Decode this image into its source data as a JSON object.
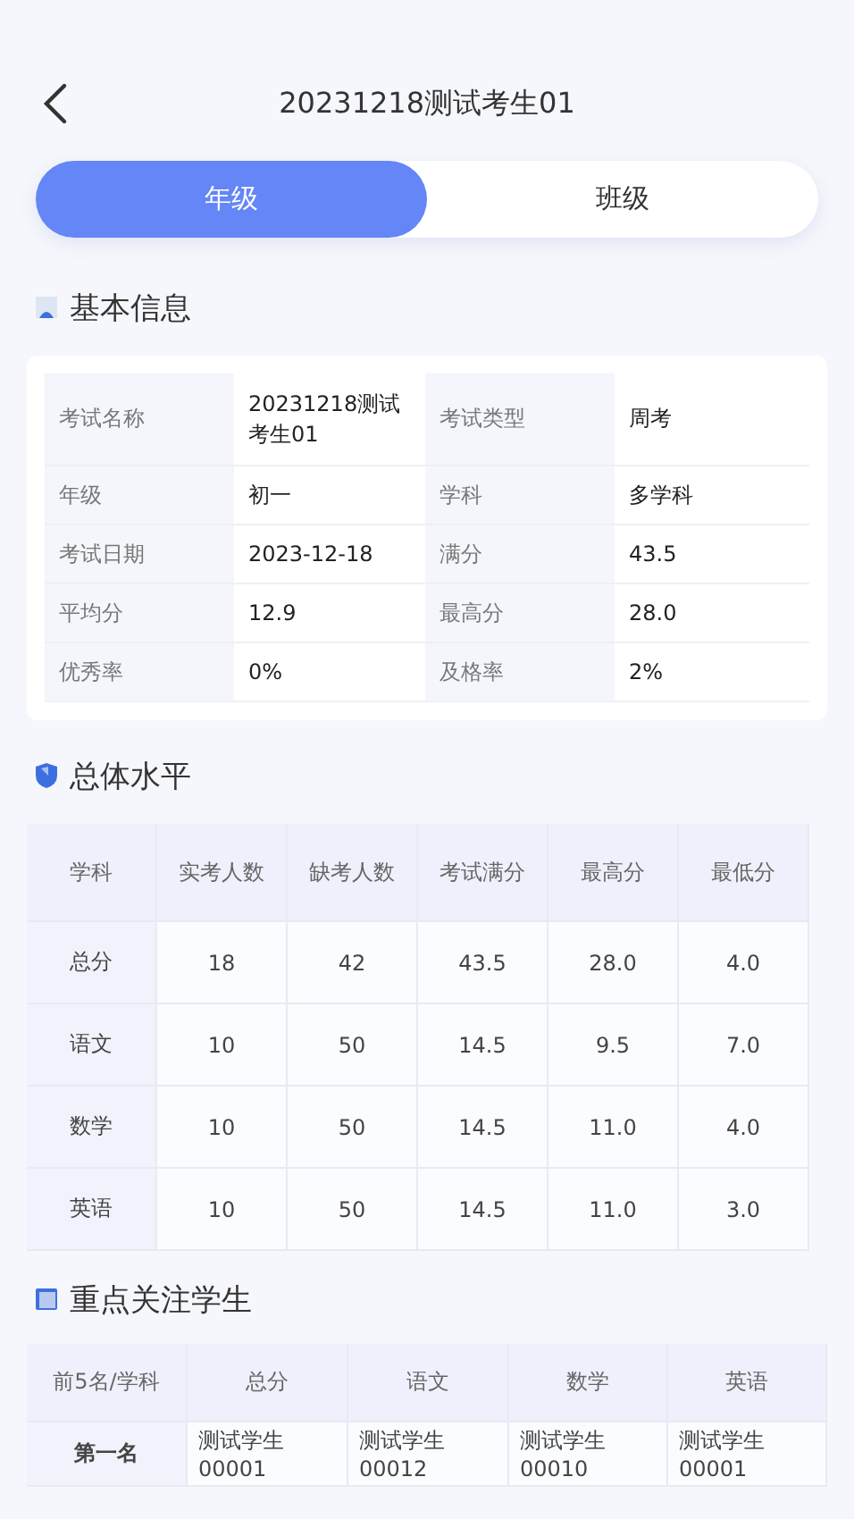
{
  "header": {
    "title": "20231218测试考生01"
  },
  "tabs": [
    {
      "label": "年级",
      "selected": true
    },
    {
      "label": "班级",
      "selected": false
    }
  ],
  "basic_info": {
    "title": "基本信息",
    "items": [
      {
        "label": "考试名称",
        "value": "20231218测试考生01"
      },
      {
        "label": "考试类型",
        "value": "周考"
      },
      {
        "label": "年级",
        "value": "初一"
      },
      {
        "label": "学科",
        "value": "多学科"
      },
      {
        "label": "考试日期",
        "value": "2023-12-18"
      },
      {
        "label": "满分",
        "value": "43.5"
      },
      {
        "label": "平均分",
        "value": "12.9"
      },
      {
        "label": "最高分",
        "value": "28.0"
      },
      {
        "label": "优秀率",
        "value": "0%"
      },
      {
        "label": "及格率",
        "value": "2%"
      }
    ]
  },
  "overall_level": {
    "title": "总体水平",
    "columns": [
      "学科",
      "实考人数",
      "缺考人数",
      "考试满分",
      "最高分",
      "最低分"
    ],
    "rows": [
      [
        "总分",
        "18",
        "42",
        "43.5",
        "28.0",
        "4.0"
      ],
      [
        "语文",
        "10",
        "50",
        "14.5",
        "9.5",
        "7.0"
      ],
      [
        "数学",
        "10",
        "50",
        "14.5",
        "11.0",
        "4.0"
      ],
      [
        "英语",
        "10",
        "50",
        "14.5",
        "11.0",
        "3.0"
      ]
    ]
  },
  "focus_students": {
    "title": "重点关注学生",
    "columns": [
      "前5名/学科",
      "总分",
      "语文",
      "数学",
      "英语"
    ],
    "rows": [
      [
        "第一名",
        "测试学生00001",
        "测试学生00012",
        "测试学生00010",
        "测试学生00001"
      ]
    ]
  }
}
